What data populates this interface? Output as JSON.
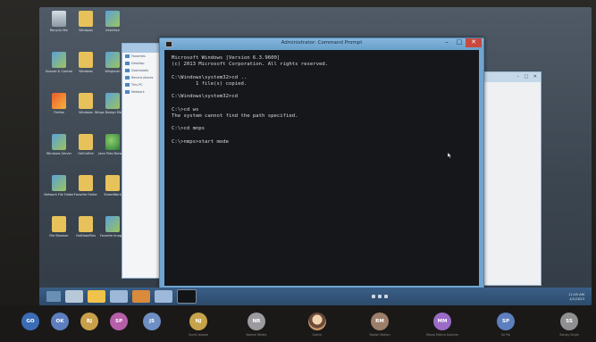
{
  "desktop": {
    "icons": [
      {
        "label": "Recycle Bin",
        "icon": "recycle-bin-icon",
        "color": "#d6dde4"
      },
      {
        "label": "Windows",
        "icon": "folder-icon",
        "color": "#e7c25a"
      },
      {
        "label": "Interface",
        "icon": "app-icon",
        "color": "#5aa0d8"
      },
      {
        "label": "Snooze & Control",
        "icon": "app-icon",
        "color": "#5aa0d8"
      },
      {
        "label": "Windows",
        "icon": "folder-icon",
        "color": "#e7c25a"
      },
      {
        "label": "Wingscan",
        "icon": "app-icon",
        "color": "#5aa0d8"
      },
      {
        "label": "Firefox",
        "icon": "firefox-icon",
        "color": "#e95c2c"
      },
      {
        "label": "Windows",
        "icon": "folder-icon",
        "color": "#e7c25a"
      },
      {
        "label": "Wings Design Manager",
        "icon": "app-icon",
        "color": "#5aa0d8"
      },
      {
        "label": "Windows Server",
        "icon": "app-icon",
        "color": "#5aa0d8"
      },
      {
        "label": "GetCoffee",
        "icon": "folder-icon",
        "color": "#e7c25a"
      },
      {
        "label": "Java Files Browser",
        "icon": "globe-icon",
        "color": "#2c7d3b"
      },
      {
        "label": "Network File Folder",
        "icon": "app-icon",
        "color": "#5aa0d8"
      },
      {
        "label": "Favorite Folder",
        "icon": "folder-icon",
        "color": "#e7c25a"
      },
      {
        "label": "SmartWork",
        "icon": "folder-icon",
        "color": "#e7c25a"
      },
      {
        "label": "File Browser",
        "icon": "folder-icon",
        "color": "#e7c25a"
      },
      {
        "label": "GetDataFiles",
        "icon": "folder-icon",
        "color": "#e7c25a"
      },
      {
        "label": "Favorite Images",
        "icon": "app-icon",
        "color": "#5aa0d8"
      }
    ]
  },
  "explorer": {
    "rows": [
      "Favorites",
      "Desktop",
      "Downloads",
      "Recent places",
      "This PC",
      "Network"
    ]
  },
  "cmd": {
    "title": "Administrator: Command Prompt",
    "lines": [
      "Microsoft Windows [Version 6.3.9600]",
      "(c) 2013 Microsoft Corporation. All rights reserved.",
      "",
      "C:\\Windows\\system32>cd ..",
      "        1 file(s) copied.",
      "",
      "C:\\Windows\\system32>cd",
      "",
      "C:\\>cd ws",
      "The system cannot find the path specified.",
      "",
      "C:\\>cd mnps",
      "",
      "C:\\>nmps>start mode"
    ],
    "buttons": {
      "minimize": "–",
      "maximize": "□",
      "close": "✕"
    }
  },
  "taskbar": {
    "time": "11:05 AM",
    "date": "1/1/2023"
  },
  "participants": [
    {
      "initials": "GO",
      "name": "",
      "color": "#3a6db5"
    },
    {
      "initials": "OK",
      "name": "",
      "color": "#5d7fbf"
    },
    {
      "initials": "BJ",
      "name": "",
      "color": "#c9a04a"
    },
    {
      "initials": "SP",
      "name": "",
      "color": "#b65fa8"
    },
    {
      "initials": "JS",
      "name": "",
      "color": "#6e8fc4"
    },
    {
      "initials": "NJ",
      "name": "Sumit Jaiswal",
      "color": "#c6a34a"
    },
    {
      "initials": "NR",
      "name": "Naresh Reddy",
      "color": "#9a9aa0"
    },
    {
      "initials": "",
      "name": "Sachin",
      "color": "#6b4a3a"
    },
    {
      "initials": "RM",
      "name": "Rajesh Mohan",
      "color": "#9c7f6a"
    },
    {
      "initials": "MM",
      "name": "Manoj Mishra Sukshm",
      "color": "#9a6bc7"
    },
    {
      "initials": "SP",
      "name": "Sri Pal",
      "color": "#5d7fbf"
    },
    {
      "initials": "SS",
      "name": "Sanjay Singh",
      "color": "#8f8f92"
    }
  ]
}
